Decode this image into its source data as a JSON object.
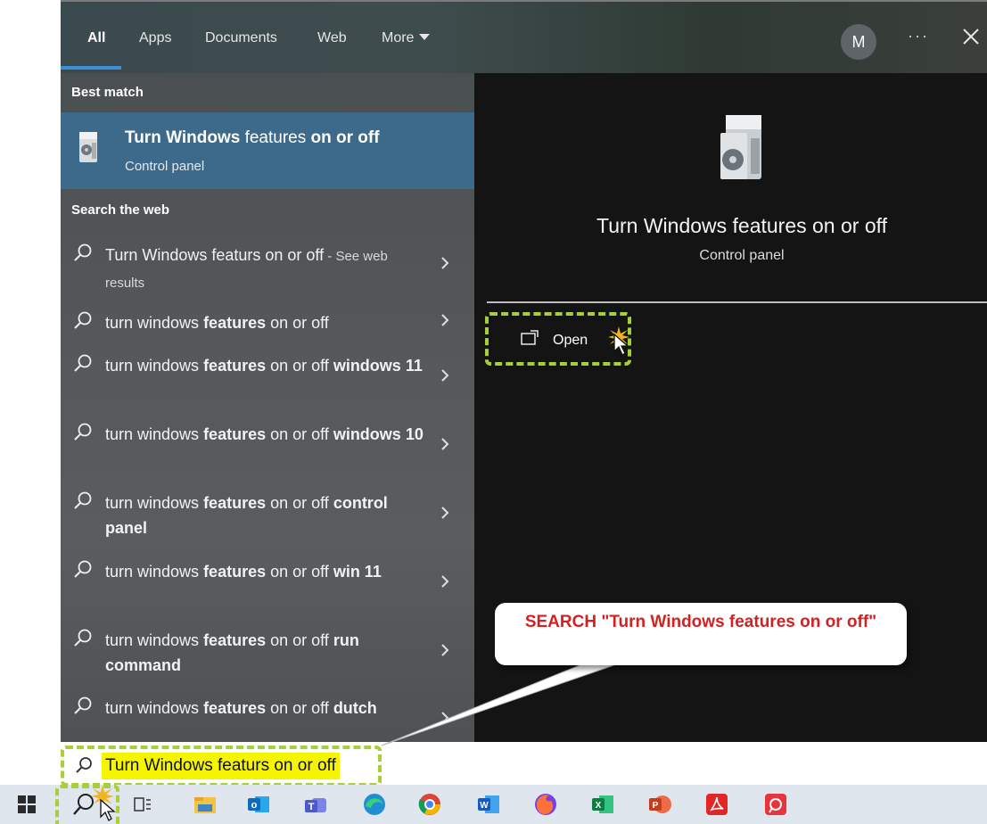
{
  "search_tabs": [
    {
      "label": "All",
      "active": true
    },
    {
      "label": "Apps",
      "active": false
    },
    {
      "label": "Documents",
      "active": false
    },
    {
      "label": "Web",
      "active": false
    },
    {
      "label": "More",
      "active": false
    }
  ],
  "account": {
    "initial": "M"
  },
  "more_options": "···",
  "best_match": {
    "heading": "Best match",
    "title_part1": "Turn Windows",
    "title_part2": " features ",
    "title_part3": "on or off",
    "subtitle": "Control panel"
  },
  "web_section": {
    "heading": "Search the web",
    "items": [
      {
        "pre": "Turn Windows featurs on or off",
        "bold": "",
        "post": "",
        "suffix": " - See web results"
      },
      {
        "pre": "turn windows ",
        "bold": "features",
        "post": " on or off",
        "suffix": ""
      },
      {
        "pre": "turn windows ",
        "bold": "features",
        "post": " on or off ",
        "bold2": "windows 11"
      },
      {
        "pre": "turn windows ",
        "bold": "features",
        "post": " on or off ",
        "bold2": "windows 10"
      },
      {
        "pre": "turn windows ",
        "bold": "features",
        "post": " on or off ",
        "bold2": "control panel"
      },
      {
        "pre": "turn windows ",
        "bold": "features",
        "post": " on or off ",
        "bold2": "win 11"
      },
      {
        "pre": "turn windows ",
        "bold": "features",
        "post": " on or off ",
        "bold2": "run command"
      },
      {
        "pre": "turn windows ",
        "bold": "features",
        "post": " on or off ",
        "bold2": "dutch"
      }
    ]
  },
  "preview": {
    "title": "Turn Windows features on or off",
    "subtitle": "Control panel",
    "open_label": "Open"
  },
  "callout_text": "SEARCH \"Turn Windows features on or off\"",
  "search_box": {
    "value": "Turn Windows featurs on or off"
  },
  "taskbar_apps": [
    "start-icon",
    "search-icon",
    "task-view-icon",
    "file-explorer-icon",
    "outlook-icon",
    "teams-icon",
    "edge-icon",
    "chrome-icon",
    "word-icon",
    "firefox-icon",
    "excel-icon",
    "powerpoint-icon",
    "acrobat-icon",
    "screenpresso-icon"
  ],
  "colors": {
    "accent": "#3a8fd6",
    "best_match_bg": "#3d6a8a",
    "highlight": "#f5f500",
    "annotation": "#a6cf3a",
    "callout_text": "#d32020"
  }
}
